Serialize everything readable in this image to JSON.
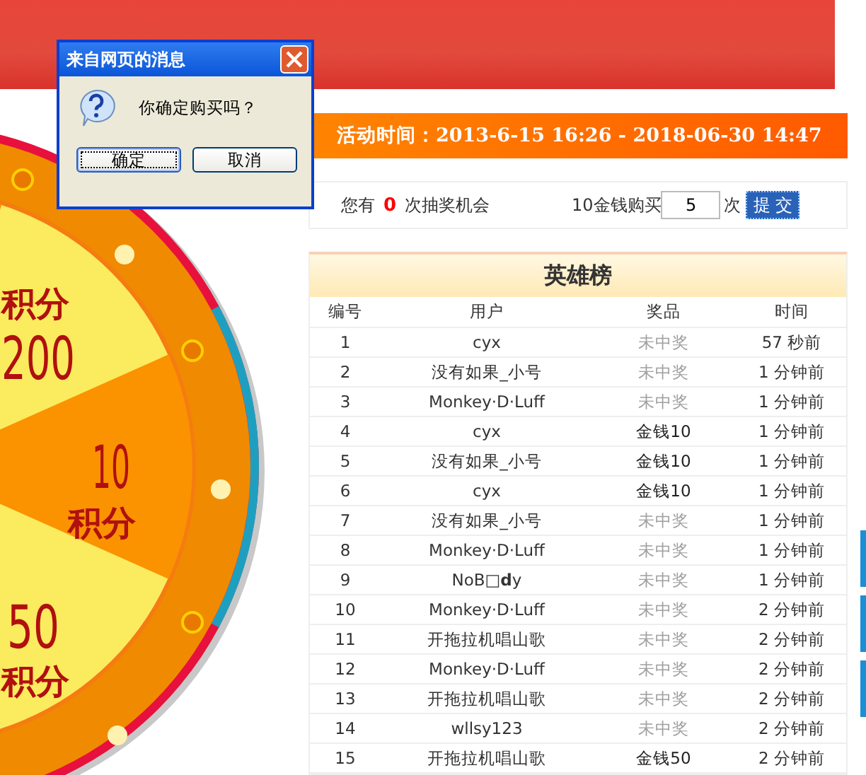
{
  "wheel": {
    "segments": [
      {
        "lines": [
          "积分",
          "200"
        ]
      },
      {
        "lines": [
          "10",
          "积分"
        ]
      },
      {
        "lines": [
          "50",
          "积分"
        ]
      }
    ]
  },
  "activity": {
    "text": "活动时间：2013-6-15 16:26 - 2018-06-30 14:47"
  },
  "chances": {
    "prefix": "您有",
    "count": "0",
    "suffix": "次抽奖机会",
    "buy_label": "10金钱购买",
    "quantity": "5",
    "unit": "次",
    "submit": "提 交"
  },
  "leaderboard": {
    "title": "英雄榜",
    "columns": [
      "编号",
      "用户",
      "奖品",
      "时间"
    ],
    "rows": [
      {
        "no": "1",
        "user": "cyx",
        "prize": "未中奖",
        "won": false,
        "time": "57 秒前"
      },
      {
        "no": "2",
        "user": "没有如果_小号",
        "prize": "未中奖",
        "won": false,
        "time": "1 分钟前"
      },
      {
        "no": "3",
        "user": "Monkey·D·Luff",
        "prize": "未中奖",
        "won": false,
        "time": "1 分钟前"
      },
      {
        "no": "4",
        "user": "cyx",
        "prize": "金钱10",
        "won": true,
        "time": "1 分钟前"
      },
      {
        "no": "5",
        "user": "没有如果_小号",
        "prize": "金钱10",
        "won": true,
        "time": "1 分钟前"
      },
      {
        "no": "6",
        "user": "cyx",
        "prize": "金钱10",
        "won": true,
        "time": "1 分钟前"
      },
      {
        "no": "7",
        "user": "没有如果_小号",
        "prize": "未中奖",
        "won": false,
        "time": "1 分钟前"
      },
      {
        "no": "8",
        "user": "Monkey·D·Luff",
        "prize": "未中奖",
        "won": false,
        "time": "1 分钟前"
      },
      {
        "no": "9",
        "user": "NoB□**d**y",
        "prize": "未中奖",
        "won": false,
        "time": "1 分钟前"
      },
      {
        "no": "10",
        "user": "Monkey·D·Luff",
        "prize": "未中奖",
        "won": false,
        "time": "2 分钟前"
      },
      {
        "no": "11",
        "user": "开拖拉机唱山歌",
        "prize": "未中奖",
        "won": false,
        "time": "2 分钟前"
      },
      {
        "no": "12",
        "user": "Monkey·D·Luff",
        "prize": "未中奖",
        "won": false,
        "time": "2 分钟前"
      },
      {
        "no": "13",
        "user": "开拖拉机唱山歌",
        "prize": "未中奖",
        "won": false,
        "time": "2 分钟前"
      },
      {
        "no": "14",
        "user": "wllsy123",
        "prize": "未中奖",
        "won": false,
        "time": "2 分钟前"
      },
      {
        "no": "15",
        "user": "开拖拉机唱山歌",
        "prize": "金钱50",
        "won": true,
        "time": "2 分钟前"
      }
    ]
  },
  "dialog": {
    "title": "来自网页的消息",
    "message": "你确定购买吗？",
    "buttons": [
      {
        "label": "确定",
        "selected": true
      },
      {
        "label": "取消",
        "selected": false
      }
    ]
  }
}
